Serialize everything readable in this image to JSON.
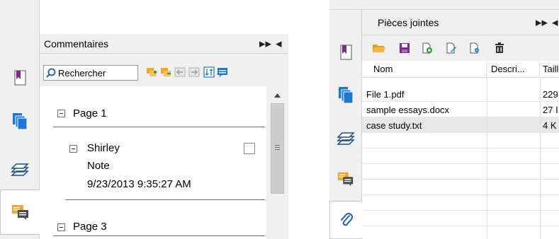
{
  "comments_panel": {
    "title": "Commentaires",
    "search": {
      "placeholder": "Rechercher",
      "value": "Rechercher"
    },
    "toolbar_icons": [
      "add-comment-icon",
      "delete-comment-icon",
      "import-icon",
      "export-icon",
      "sort-icon",
      "note-icon"
    ],
    "side_tabs": [
      {
        "name": "bookmark-icon",
        "active": false
      },
      {
        "name": "pages-icon",
        "active": false
      },
      {
        "name": "layers-icon",
        "active": false
      },
      {
        "name": "comments-icon",
        "active": true
      }
    ],
    "groups": [
      {
        "label": "Page 1",
        "items": [
          {
            "author": "Shirley",
            "type": "Note",
            "date": "9/23/2013 9:35:27 AM"
          }
        ]
      },
      {
        "label": "Page 3",
        "items": []
      }
    ]
  },
  "attachments_panel": {
    "title": "Pièces jointes",
    "toolbar_icons": [
      "open-folder-icon",
      "save-icon",
      "add-file-icon",
      "edit-file-icon",
      "file-settings-icon",
      "delete-icon"
    ],
    "side_tabs": [
      {
        "name": "bookmark-icon",
        "active": false
      },
      {
        "name": "pages-icon",
        "active": false
      },
      {
        "name": "layers-icon",
        "active": false
      },
      {
        "name": "comments-icon",
        "active": false
      },
      {
        "name": "paperclip-icon",
        "active": true
      }
    ],
    "columns": [
      "Nom",
      "Descri...",
      "Taill"
    ],
    "rows": [
      {
        "name": "File 1.pdf",
        "description": "",
        "size": "229",
        "selected": false
      },
      {
        "name": "sample essays.docx",
        "description": "",
        "size": "27 I",
        "selected": false
      },
      {
        "name": "case study.txt",
        "description": "",
        "size": "4 K",
        "selected": true
      }
    ]
  },
  "colors": {
    "accent_orange": "#f5a623",
    "accent_purple": "#7b2a8a",
    "accent_blue": "#1e78d2",
    "panel_bg": "#f0f0f0"
  }
}
